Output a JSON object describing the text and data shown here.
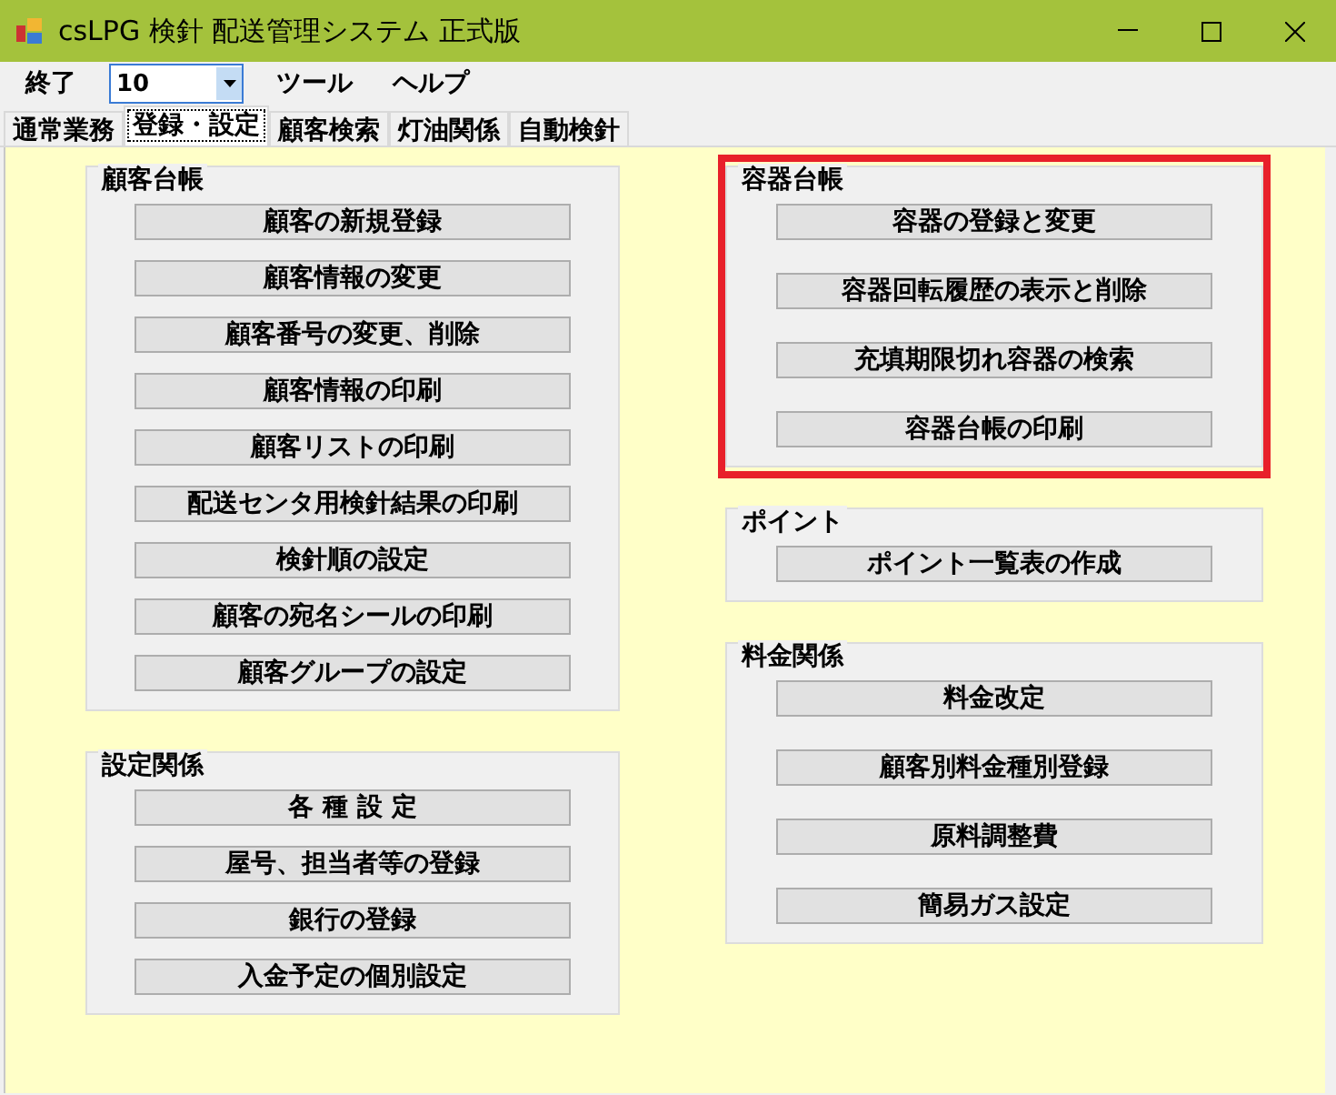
{
  "window": {
    "title": "csLPG 検針 配送管理システム 正式版"
  },
  "menu": {
    "items_before": [
      "終了"
    ],
    "combo": {
      "value": "10"
    },
    "items_after": [
      "ツール",
      "ヘルプ"
    ]
  },
  "tabs": [
    {
      "label": "通常業務",
      "selected": false
    },
    {
      "label": "登録・設定",
      "selected": true
    },
    {
      "label": "顧客検索",
      "selected": false
    },
    {
      "label": "灯油関係",
      "selected": false
    },
    {
      "label": "自動検針",
      "selected": false
    }
  ],
  "columns": [
    {
      "groups": [
        {
          "title": "顧客台帳",
          "highlighted": false,
          "buttons": [
            "顧客の新規登録",
            "顧客情報の変更",
            "顧客番号の変更、削除",
            "顧客情報の印刷",
            "顧客リストの印刷",
            "配送センタ用検針結果の印刷",
            "検針順の設定",
            "顧客の宛名シールの印刷",
            "顧客グループの設定"
          ]
        },
        {
          "title": "設定関係",
          "highlighted": false,
          "buttons": [
            "各 種 設 定",
            "屋号、担当者等の登録",
            "銀行の登録",
            "入金予定の個別設定"
          ]
        }
      ]
    },
    {
      "groups": [
        {
          "title": "容器台帳",
          "highlighted": true,
          "buttons": [
            "容器の登録と変更",
            "容器回転履歴の表示と削除",
            "充填期限切れ容器の検索",
            "容器台帳の印刷"
          ]
        },
        {
          "title": "ポイント",
          "highlighted": false,
          "buttons": [
            "ポイント一覧表の作成"
          ]
        },
        {
          "title": "料金関係",
          "highlighted": false,
          "buttons": [
            "料金改定",
            "顧客別料金種別登録",
            "原料調整費",
            "簡易ガス設定"
          ]
        }
      ]
    }
  ]
}
